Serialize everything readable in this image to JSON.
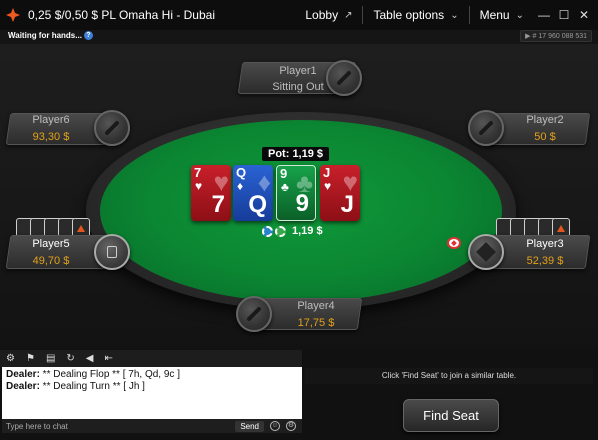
{
  "window": {
    "title": "0,25 $/0,50 $ PL Omaha Hi - Dubai",
    "lobby": "Lobby",
    "table_options": "Table options",
    "menu": "Menu",
    "minimize": "—",
    "maximize": "☐",
    "close": "✕"
  },
  "info": {
    "status": "Waiting for hands...",
    "help": "?",
    "hand_id": "# 17 960 088 531"
  },
  "players": {
    "p1": {
      "name": "Player1",
      "status": "Sitting Out"
    },
    "p2": {
      "name": "Player2",
      "stack": "50 $"
    },
    "p3": {
      "name": "Player3",
      "stack": "52,39 $"
    },
    "p4": {
      "name": "Player4",
      "stack": "17,75 $"
    },
    "p5": {
      "name": "Player5",
      "stack": "49,70 $"
    },
    "p6": {
      "name": "Player6",
      "stack": "93,30 $"
    }
  },
  "pot": {
    "label": "Pot: 1,19 $",
    "chips_amount": "1,19 $"
  },
  "board": [
    {
      "rank": "7",
      "suit": "♥",
      "color": "hearts"
    },
    {
      "rank": "Q",
      "suit": "♦",
      "color": "diamonds"
    },
    {
      "rank": "9",
      "suit": "♣",
      "color": "clubs"
    },
    {
      "rank": "J",
      "suit": "♥",
      "color": "hearts"
    }
  ],
  "chat": {
    "lines": [
      {
        "speaker": "Dealer:",
        "text": " ** Dealing Flop ** [ 7h, Qd, 9c ]"
      },
      {
        "speaker": "Dealer:",
        "text": " ** Dealing Turn ** [ Jh ]"
      }
    ],
    "placeholder": "Type here to chat",
    "send": "Send"
  },
  "message": "Click 'Find Seat' to join a similar table.",
  "find_seat": "Find Seat",
  "colors": {
    "felt": "#0b8532",
    "stack": "#e3a21a",
    "accent": "#e2571e"
  }
}
